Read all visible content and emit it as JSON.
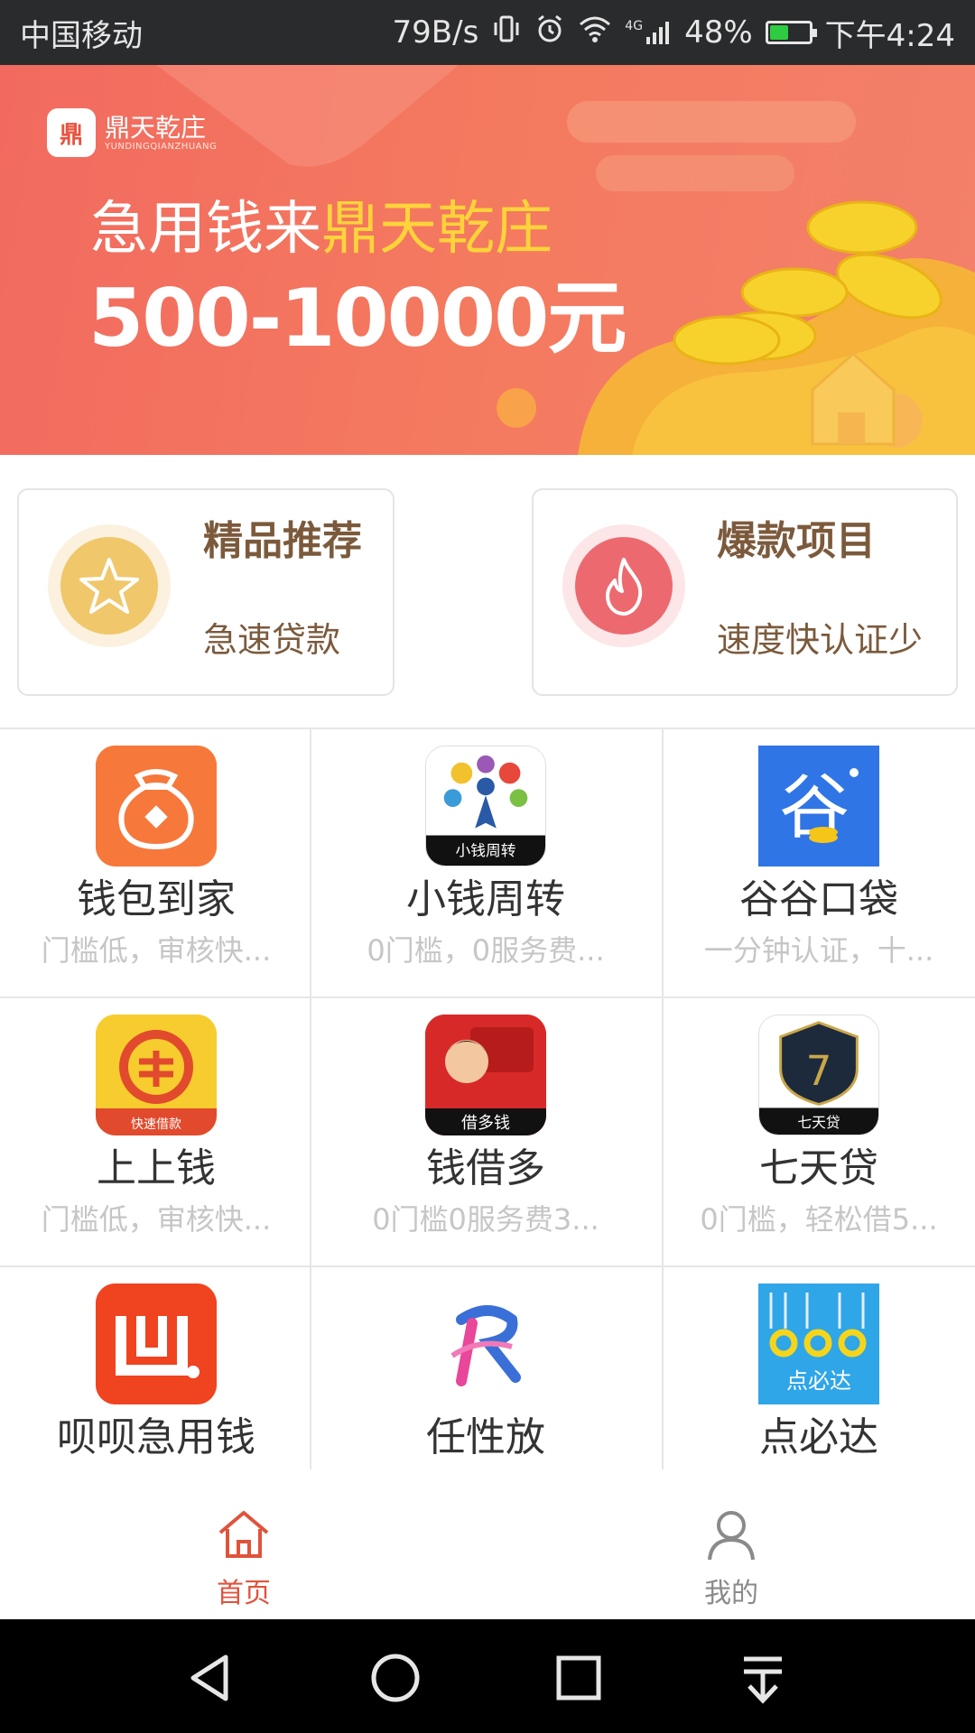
{
  "status_bar": {
    "carrier": "中国移动",
    "net_speed": "79B/s",
    "signal_type": "4G",
    "battery_percent": "48%",
    "battery_level": 0.48,
    "time": "下午4:24",
    "icons": [
      "vibrate-icon",
      "alarm-icon",
      "wifi-icon",
      "signal-icon",
      "battery-icon"
    ]
  },
  "banner": {
    "logo_text": "鼎天乾庄",
    "logo_subtext": "YUNDINGQIANZHUANG",
    "line1_prefix": "急用钱来",
    "line1_highlight": "鼎天乾庄",
    "line2": "500-10000元",
    "colors": {
      "bg": "#f26a5f",
      "highlight": "#ffd33a"
    }
  },
  "features": [
    {
      "title": "精品推荐",
      "subtitle": "急速贷款",
      "icon": "star-icon",
      "color": "#f0c76a"
    },
    {
      "title": "爆款项目",
      "subtitle": "速度快认证少",
      "icon": "flame-icon",
      "color": "#ec6a6f"
    }
  ],
  "products": [
    {
      "name": "钱包到家",
      "desc": "门槛低，审核快...",
      "icon": "money-bag-icon",
      "icon_text": ""
    },
    {
      "name": "小钱周转",
      "desc": "0门槛，0服务费...",
      "icon": "xiaoqian-logo-icon",
      "icon_text": "小钱周转"
    },
    {
      "name": "谷谷口袋",
      "desc": "一分钟认证，十...",
      "icon": "gugu-logo-icon",
      "icon_text": "谷"
    },
    {
      "name": "上上钱",
      "desc": "门槛低，审核快...",
      "icon": "kuaisu-logo-icon",
      "icon_text": "快速借款"
    },
    {
      "name": "钱借多",
      "desc": "0门槛0服务费3...",
      "icon": "jieduoqian-logo-icon",
      "icon_text": "借多钱"
    },
    {
      "name": "七天贷",
      "desc": "0门槛，轻松借5...",
      "icon": "qitiandai-logo-icon",
      "icon_text": "七天贷"
    },
    {
      "name": "呗呗急用钱",
      "desc": "",
      "icon": "beibei-logo-icon",
      "icon_text": ""
    },
    {
      "name": "任性放",
      "desc": "",
      "icon": "renxing-logo-icon",
      "icon_text": ""
    },
    {
      "name": "点必达",
      "desc": "",
      "icon": "dianbida-logo-icon",
      "icon_text": "点必达"
    }
  ],
  "bottom_nav": [
    {
      "label": "首页",
      "icon": "home-icon",
      "active": true
    },
    {
      "label": "我的",
      "icon": "user-icon",
      "active": false
    }
  ],
  "colors": {
    "accent": "#e0533b",
    "inactive": "#8a8a8a"
  },
  "system_nav": [
    "back-icon",
    "home-circle-icon",
    "recents-icon",
    "notification-pull-icon"
  ]
}
